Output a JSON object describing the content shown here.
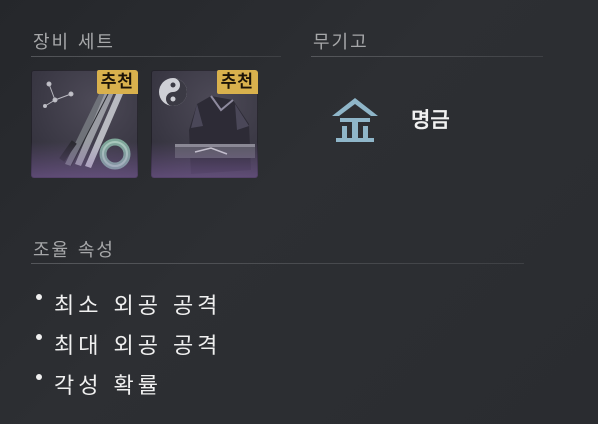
{
  "equipment_set": {
    "title": "장비 세트",
    "items": [
      {
        "name": "weapon-set",
        "badge": "추천"
      },
      {
        "name": "armor-set",
        "badge": "추천"
      }
    ]
  },
  "arsenal": {
    "title": "무기고",
    "weapon_name": "명금",
    "icon": "myeonggeum-emblem-icon",
    "icon_color": "#8fb6c9"
  },
  "tuning": {
    "title": "조율 속성",
    "stats": [
      "최소 외공 공격",
      "최대 외공 공격",
      "각성 확률"
    ]
  },
  "colors": {
    "badge_bg": "#d9b14d",
    "background": "#2a2c30"
  }
}
